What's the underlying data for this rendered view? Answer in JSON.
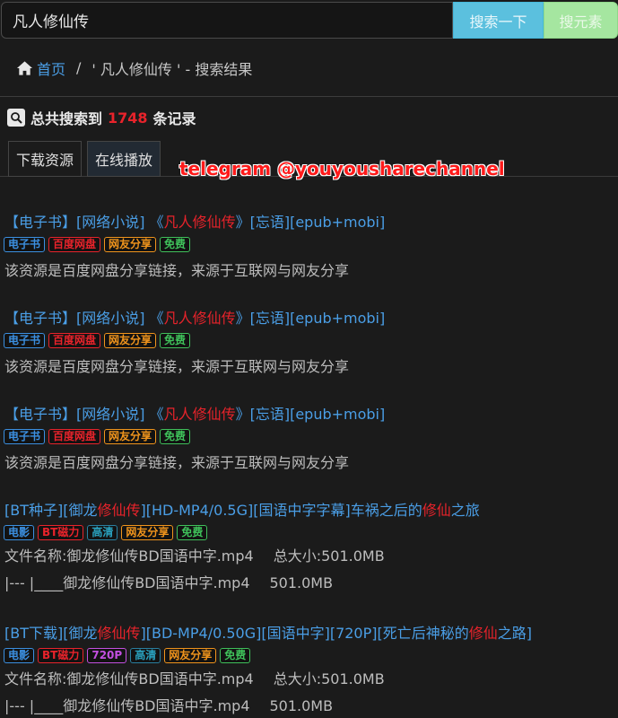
{
  "search": {
    "value": "凡人修仙传",
    "button_search": "搜索一下",
    "button_yuan": "搜元素"
  },
  "breadcrumb": {
    "home": "首页",
    "sep": "/",
    "current": "' 凡人修仙传 ' - 搜索结果"
  },
  "summary": {
    "prefix": "总共搜索到",
    "count": "1748",
    "suffix": "条记录"
  },
  "tabs": [
    "下载资源",
    "在线播放"
  ],
  "watermark": "telegram @youyousharechannel",
  "colors": {
    "accent": "#4a9ee6",
    "highlight": "#e8232b",
    "search_btn": "#5bc0de",
    "yuan_btn": "#a5e6a0"
  },
  "results": [
    {
      "title_pre": "【电子书】[网络小说] 《",
      "title_hl": "凡人修仙传",
      "title_post": "》[忘语][epub+mobi]",
      "tags": [
        {
          "label": "电子书",
          "color": "blue"
        },
        {
          "label": "百度网盘",
          "color": "red"
        },
        {
          "label": "网友分享",
          "color": "orange"
        },
        {
          "label": "免费",
          "color": "green"
        }
      ],
      "desc": "该资源是百度网盘分享链接，来源于互联网与网友分享"
    },
    {
      "title_pre": "【电子书】[网络小说] 《",
      "title_hl": "凡人修仙传",
      "title_post": "》[忘语][epub+mobi]",
      "tags": [
        {
          "label": "电子书",
          "color": "blue"
        },
        {
          "label": "百度网盘",
          "color": "red"
        },
        {
          "label": "网友分享",
          "color": "orange"
        },
        {
          "label": "免费",
          "color": "green"
        }
      ],
      "desc": "该资源是百度网盘分享链接，来源于互联网与网友分享"
    },
    {
      "title_pre": "【电子书】[网络小说] 《",
      "title_hl": "凡人修仙传",
      "title_post": "》[忘语][epub+mobi]",
      "tags": [
        {
          "label": "电子书",
          "color": "blue"
        },
        {
          "label": "百度网盘",
          "color": "red"
        },
        {
          "label": "网友分享",
          "color": "orange"
        },
        {
          "label": "免费",
          "color": "green"
        }
      ],
      "desc": "该资源是百度网盘分享链接，来源于互联网与网友分享"
    },
    {
      "title_segments": [
        {
          "t": "[BT种子][御龙",
          "h": false
        },
        {
          "t": "修仙传",
          "h": true
        },
        {
          "t": "][HD-MP4/0.5G][国语中字字幕]车祸之后的",
          "h": false
        },
        {
          "t": "修仙",
          "h": true
        },
        {
          "t": "之旅",
          "h": false
        }
      ],
      "tags": [
        {
          "label": "电影",
          "color": "blue"
        },
        {
          "label": "BT磁力",
          "color": "red"
        },
        {
          "label": "高清",
          "color": "teal"
        },
        {
          "label": "网友分享",
          "color": "orange"
        },
        {
          "label": "免费",
          "color": "green"
        }
      ],
      "file_line": {
        "name_label": "文件名称:御龙修仙传BD国语中字.mp4",
        "size_label": "总大小:501.0MB"
      },
      "tree_line": {
        "name": "|--- |____御龙修仙传BD国语中字.mp4",
        "size": "501.0MB"
      }
    },
    {
      "title_segments": [
        {
          "t": "[BT下载][御龙",
          "h": false
        },
        {
          "t": "修仙传",
          "h": true
        },
        {
          "t": "][BD-MP4/0.50G][国语中字][720P][死亡后神秘的",
          "h": false
        },
        {
          "t": "修仙",
          "h": true
        },
        {
          "t": "之路]",
          "h": false
        }
      ],
      "tags": [
        {
          "label": "电影",
          "color": "blue"
        },
        {
          "label": "BT磁力",
          "color": "red"
        },
        {
          "label": "720P",
          "color": "purple"
        },
        {
          "label": "高清",
          "color": "teal"
        },
        {
          "label": "网友分享",
          "color": "orange"
        },
        {
          "label": "免费",
          "color": "green"
        }
      ],
      "file_line": {
        "name_label": "文件名称:御龙修仙传BD国语中字.mp4",
        "size_label": "总大小:501.0MB"
      },
      "tree_line": {
        "name": "|--- |____御龙修仙传BD国语中字.mp4",
        "size": "501.0MB"
      }
    }
  ]
}
